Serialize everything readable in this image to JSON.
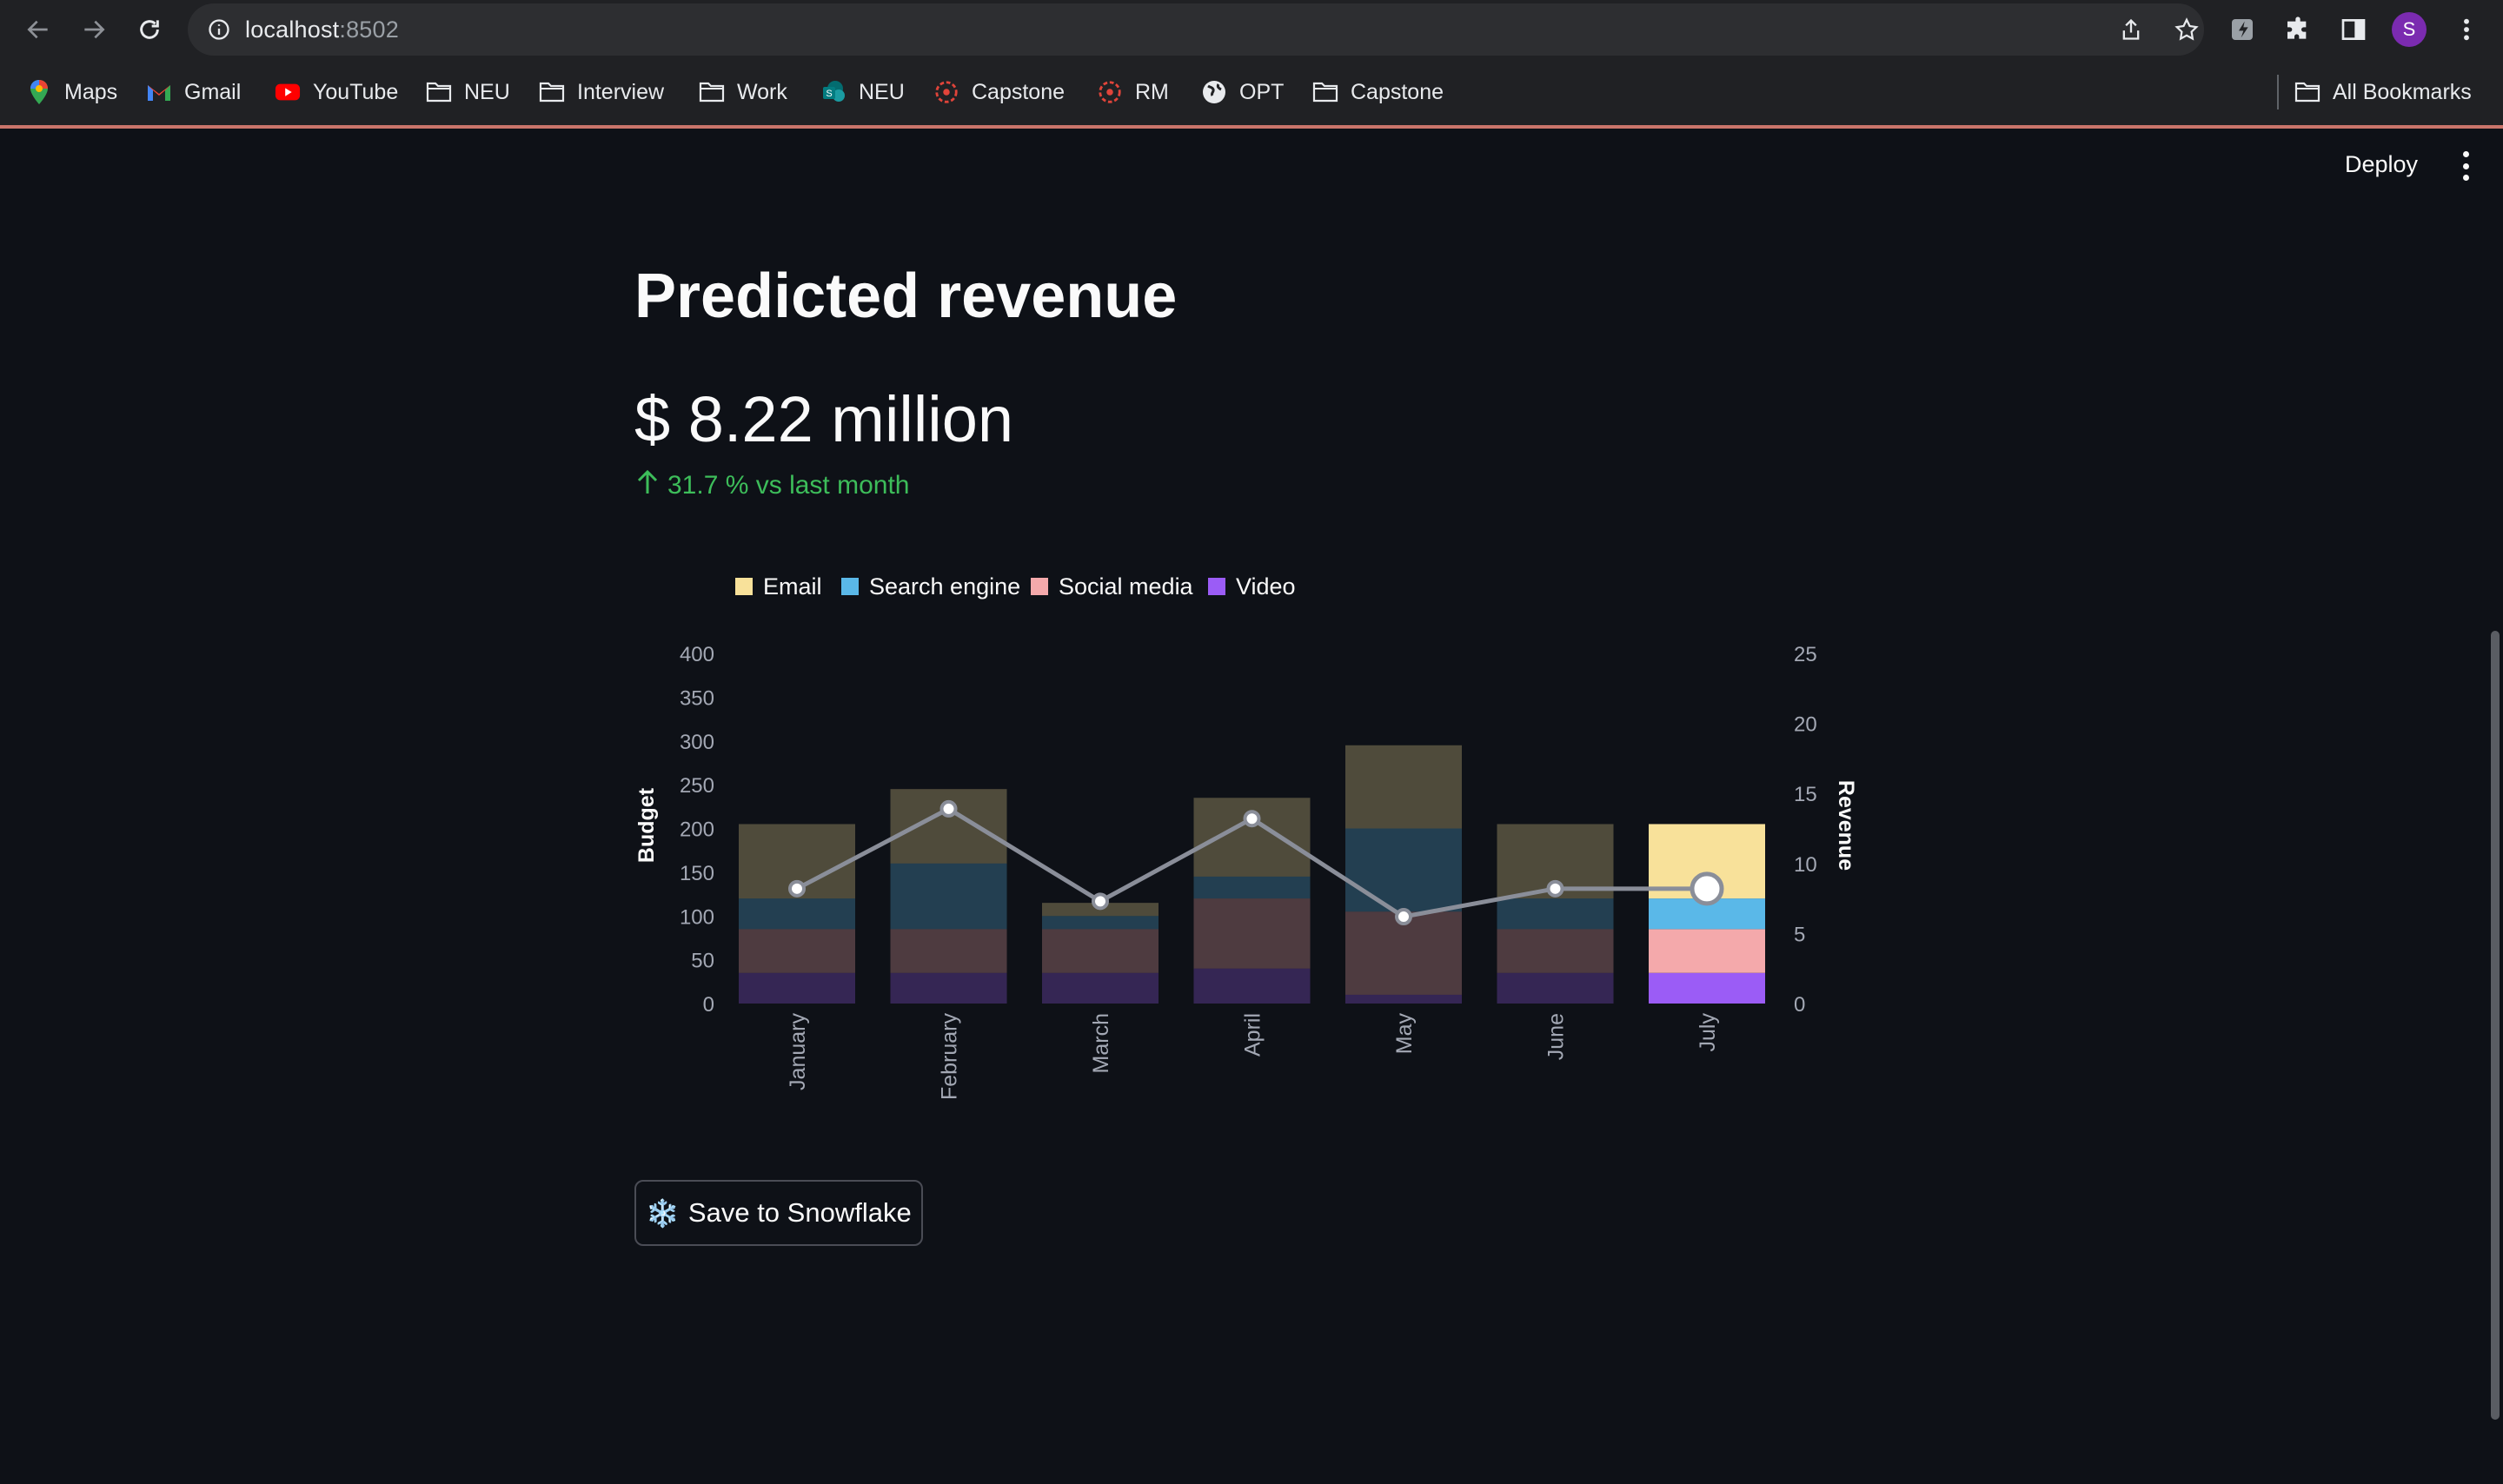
{
  "browser": {
    "url_host": "localhost",
    "url_port": ":8502",
    "profile_initial": "S",
    "bookmarks": [
      {
        "label": "Maps",
        "icon": "maps-icon"
      },
      {
        "label": "Gmail",
        "icon": "gmail-icon"
      },
      {
        "label": "YouTube",
        "icon": "youtube-icon"
      },
      {
        "label": "NEU",
        "icon": "folder-icon"
      },
      {
        "label": "Interview",
        "icon": "folder-icon"
      },
      {
        "label": "Work",
        "icon": "folder-icon"
      },
      {
        "label": "NEU",
        "icon": "sharepoint-icon"
      },
      {
        "label": "Capstone",
        "icon": "capstone-icon"
      },
      {
        "label": "RM",
        "icon": "capstone-icon"
      },
      {
        "label": "OPT",
        "icon": "globe-icon"
      },
      {
        "label": "Capstone",
        "icon": "folder-icon"
      }
    ],
    "all_bookmarks": "All Bookmarks"
  },
  "app": {
    "deploy_label": "Deploy",
    "title": "Predicted revenue",
    "metric_value": "$ 8.22 million",
    "metric_delta": "31.7 % vs last month",
    "save_button": "Save to Snowflake",
    "save_button_icon": "❄️",
    "colors": {
      "background": "#0e1117",
      "delta_positive": "#3dbd5a"
    }
  },
  "chart_data": {
    "type": "bar",
    "stacked": true,
    "categories": [
      "January",
      "February",
      "March",
      "April",
      "May",
      "June",
      "July"
    ],
    "highlighted_category": "July",
    "series": [
      {
        "name": "Video",
        "color": "#9b5cf6",
        "values": [
          35,
          35,
          35,
          40,
          10,
          35,
          35
        ]
      },
      {
        "name": "Social media",
        "color": "#f4a9ab",
        "values": [
          50,
          50,
          50,
          80,
          95,
          50,
          50
        ]
      },
      {
        "name": "Search engine",
        "color": "#5ab8e8",
        "values": [
          35,
          75,
          15,
          25,
          95,
          35,
          35
        ]
      },
      {
        "name": "Email",
        "color": "#f8e19a",
        "values": [
          85,
          85,
          15,
          90,
          95,
          85,
          85
        ]
      }
    ],
    "line": {
      "name": "Revenue",
      "values": [
        8.2,
        13.9,
        7.3,
        13.2,
        6.2,
        8.2,
        8.2
      ],
      "color": "#8a8e99"
    },
    "legend": [
      "Email",
      "Search engine",
      "Social media",
      "Video"
    ],
    "ylabel_left": "Budget",
    "ylabel_right": "Revenue",
    "yticks_left": [
      0,
      50,
      100,
      150,
      200,
      250,
      300,
      350,
      400
    ],
    "yticks_right": [
      0,
      5,
      10,
      15,
      20,
      25
    ],
    "ylim_left": [
      0,
      400
    ],
    "ylim_right": [
      0,
      25
    ]
  }
}
